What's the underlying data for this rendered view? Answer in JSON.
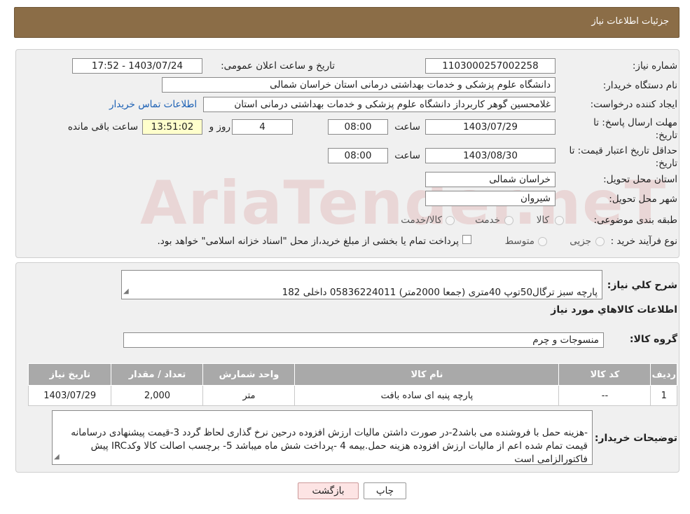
{
  "header": {
    "title": "جزئیات اطلاعات نیاز"
  },
  "watermark": {
    "text": "AriaTender.neT"
  },
  "form": {
    "need_number": {
      "label": "شماره نیاز:",
      "value": "1103000257002258"
    },
    "announce": {
      "label": "تاریخ و ساعت اعلان عمومی:",
      "value": "1403/07/24 - 17:52"
    },
    "buyer_org": {
      "label": "نام دستگاه خریدار:",
      "value": "دانشگاه علوم پزشکی و خدمات بهداشتی درمانی استان خراسان شمالی"
    },
    "requester": {
      "label": "ایجاد کننده درخواست:",
      "value": "غلامحسین گوهر کاربرداز  دانشگاه علوم پزشکی و خدمات بهداشتی درمانی استان",
      "contact_link": "اطلاعات تماس خریدار"
    },
    "reply_deadline": {
      "label": "مهلت ارسال پاسخ: تا تاریخ:",
      "date": "1403/07/29",
      "time_label": "ساعت",
      "time": "08:00",
      "days": "4",
      "days_label": "روز و",
      "remaining": "13:51:02",
      "remaining_label": "ساعت باقی مانده"
    },
    "price_validity": {
      "label": "حداقل تاریخ اعتبار قیمت: تا تاریخ:",
      "date": "1403/08/30",
      "time_label": "ساعت",
      "time": "08:00"
    },
    "province": {
      "label": "استان محل تحویل:",
      "value": "خراسان شمالی"
    },
    "city": {
      "label": "شهر محل تحویل:",
      "value": "شیروان"
    },
    "category": {
      "label": "طبقه بندی موضوعی:",
      "options": [
        "کالا",
        "خدمت",
        "کالا/خدمت"
      ]
    },
    "process": {
      "label": "نوع فرآیند خرید :",
      "options": [
        "جزیی",
        "متوسط"
      ],
      "note": "پرداخت تمام یا بخشی از مبلغ خرید،از محل \"اسناد خزانه اسلامی\" خواهد بود."
    }
  },
  "summary": {
    "label": "شرح کلي نياز:",
    "value": "پارچه سبز ترگال50توپ 40متری (جمعا 2000متر) 05836224011 داخلی 182"
  },
  "items_section": {
    "title": "اطلاعات کالاهاي مورد نياز"
  },
  "goods_group": {
    "label": "گروه کالا:",
    "value": "منسوجات و چرم"
  },
  "table": {
    "headers": [
      "ردیف",
      "کد کالا",
      "نام کالا",
      "واحد شمارش",
      "تعداد / مقدار",
      "تاریخ نیاز"
    ],
    "rows": [
      [
        "1",
        "--",
        "پارچه پنبه ای ساده بافت",
        "متر",
        "2,000",
        "1403/07/29"
      ]
    ]
  },
  "buyer_notes": {
    "label": "توضیحات خریدار:",
    "value": "-هزینه حمل با فروشنده می باشد2-در صورت داشتن مالیات ارزش افزوده درحین نرخ گذاری لحاظ گردد 3-قیمت پیشنهادی درسامانه  قیمت تمام شده اعم از مالیات ارزش افزوده هزینه حمل.بیمه  4 -پرداخت شش ماه میباشد 5- برچسب اصالت کالا وکدIRC پیش فاکتورالزامی است"
  },
  "buttons": {
    "print": "چاپ",
    "back": "بازگشت"
  }
}
